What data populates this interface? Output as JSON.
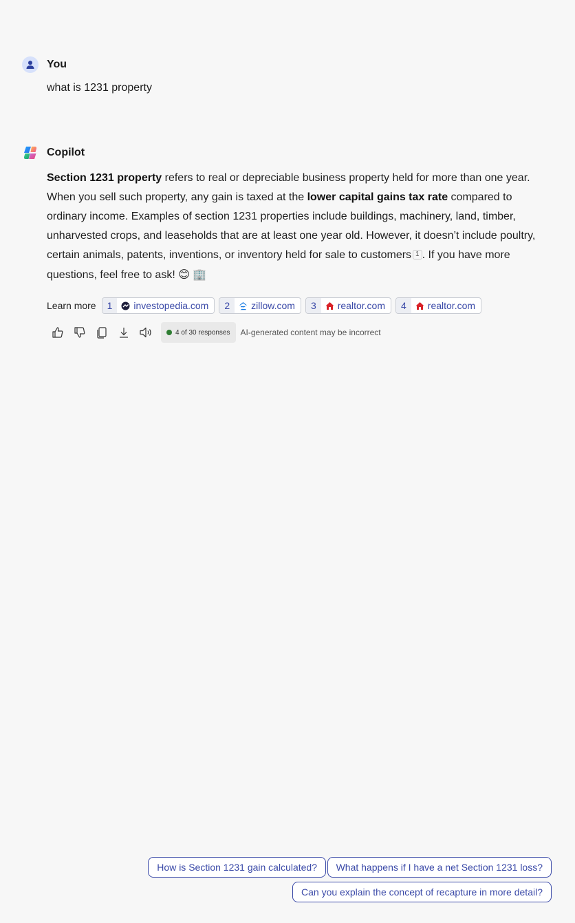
{
  "colors": {
    "accent": "#3b4aa8",
    "background": "#f7f7f7",
    "status_green": "#2e7d32"
  },
  "user_message": {
    "sender": "You",
    "avatar_icon": "person-icon",
    "text": "what is 1231 property"
  },
  "bot_message": {
    "sender": "Copilot",
    "avatar_icon": "copilot-logo-icon",
    "p1_bold": "Section 1231 property",
    "p1_a": " refers to real or depreciable business property held for more than one year. When you sell such property, any gain is taxed at the ",
    "p1_bold2": "lower capital gains tax rate",
    "p1_b": " compared to ordinary income. Examples of section 1231 properties include buildings, machinery, land, timber, unharvested crops, and leaseholds that are at least one year old. However, it doesn’t include poultry, certain animals, patents, inventions, or inventory held for sale to customers",
    "cite": "1",
    "p1_c": ". If you have more questions, feel free to ask! ",
    "emoji1": "😊",
    "emoji2": "🏢"
  },
  "learn_more": {
    "label": "Learn more",
    "sources": [
      {
        "num": "1",
        "host": "investopedia.com",
        "icon": "investopedia-icon"
      },
      {
        "num": "2",
        "host": "zillow.com",
        "icon": "zillow-icon"
      },
      {
        "num": "3",
        "host": "realtor.com",
        "icon": "realtor-icon"
      },
      {
        "num": "4",
        "host": "realtor.com",
        "icon": "realtor-icon"
      }
    ]
  },
  "actions": {
    "icons": [
      "thumbs-up-icon",
      "thumbs-down-icon",
      "copy-icon",
      "download-icon",
      "read-aloud-icon"
    ],
    "responses": "4 of 30 responses",
    "disclaimer": "AI-generated content may be incorrect"
  },
  "suggestions": [
    "How is Section 1231 gain calculated?",
    "What happens if I have a net Section 1231 loss?",
    "Can you explain the concept of recapture in more detail?"
  ]
}
